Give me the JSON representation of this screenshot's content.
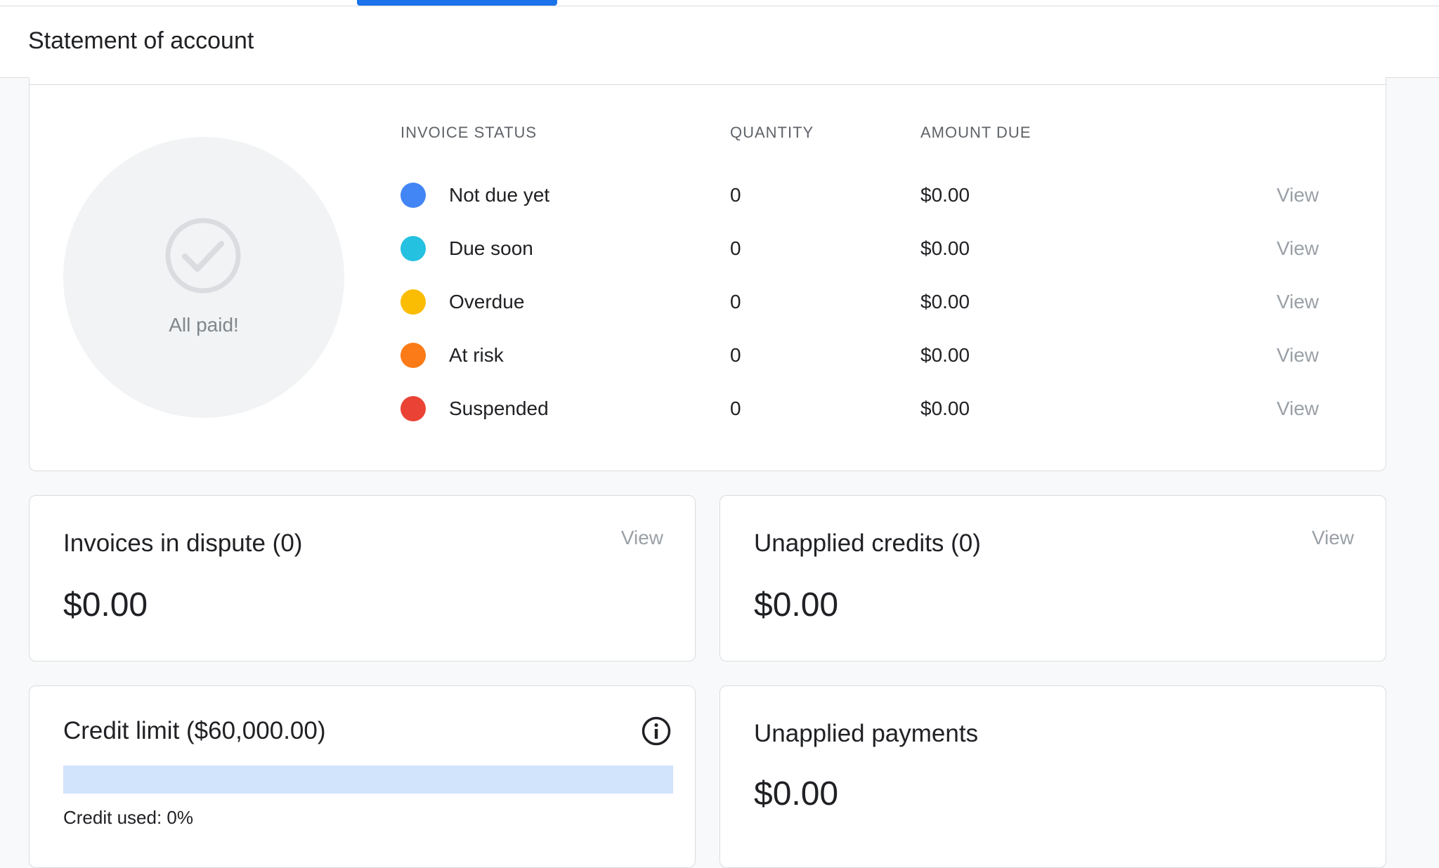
{
  "page": {
    "title": "Statement of account"
  },
  "summary": {
    "badge_label": "All paid!",
    "columns": {
      "status": "INVOICE STATUS",
      "quantity": "QUANTITY",
      "amount": "AMOUNT DUE"
    },
    "rows": [
      {
        "label": "Not due yet",
        "quantity": "0",
        "amount": "$0.00",
        "action": "View",
        "color": "#4285f4"
      },
      {
        "label": "Due soon",
        "quantity": "0",
        "amount": "$0.00",
        "action": "View",
        "color": "#24c1e0"
      },
      {
        "label": "Overdue",
        "quantity": "0",
        "amount": "$0.00",
        "action": "View",
        "color": "#fbbc04"
      },
      {
        "label": "At risk",
        "quantity": "0",
        "amount": "$0.00",
        "action": "View",
        "color": "#fa7b17"
      },
      {
        "label": "Suspended",
        "quantity": "0",
        "amount": "$0.00",
        "action": "View",
        "color": "#ea4335"
      }
    ]
  },
  "disputes": {
    "title": "Invoices in dispute (0)",
    "amount": "$0.00",
    "action": "View"
  },
  "credits": {
    "title": "Unapplied credits (0)",
    "amount": "$0.00",
    "action": "View"
  },
  "credit_limit": {
    "title": "Credit limit ($60,000.00)",
    "used_label": "Credit used: 0%",
    "used_fraction": 0
  },
  "payments": {
    "title": "Unapplied payments",
    "amount": "$0.00"
  }
}
